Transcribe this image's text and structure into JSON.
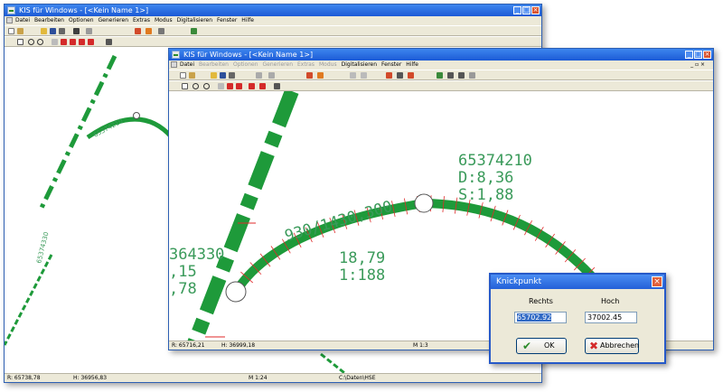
{
  "back_window": {
    "title": "KIS für Windows - [<Kein Name 1>]",
    "menu": [
      "Datei",
      "Bearbeiten",
      "Optionen",
      "Generieren",
      "Extras",
      "Modus",
      "Digitalisieren",
      "Fenster",
      "Hilfe"
    ],
    "status": {
      "rechts": "R: 65738,78",
      "hoch": "H: 36956,83",
      "scale": "M 1:24",
      "path": "C:\\Daten\\HSE"
    },
    "map_labels": {
      "curve": "65374210",
      "line": "65374330"
    }
  },
  "front_window": {
    "title": "KIS für Windows - [<Kein Name 1>]",
    "menu": [
      {
        "label": "Datei",
        "dim": false
      },
      {
        "label": "Bearbeiten",
        "dim": true
      },
      {
        "label": "Optionen",
        "dim": true
      },
      {
        "label": "Generieren",
        "dim": true
      },
      {
        "label": "Extras",
        "dim": true
      },
      {
        "label": "Modus",
        "dim": true
      },
      {
        "label": "Digitalisieren",
        "dim": false
      },
      {
        "label": "Fenster",
        "dim": false
      },
      {
        "label": "Hilfe",
        "dim": false
      }
    ],
    "status": {
      "rechts": "R: 65716,21",
      "hoch": "H: 36999,18",
      "scale": "M 1:3"
    },
    "map_labels": {
      "id": "65374210",
      "d": "D:8,36",
      "s": "S:1,88",
      "radius": "930/1430,300",
      "value1": "18,79",
      "value2": "1:188",
      "left1": "364330",
      "left2": ",15",
      "left3": ",78"
    }
  },
  "dialog": {
    "title": "Knickpunkt",
    "rechts_label": "Rechts",
    "hoch_label": "Hoch",
    "rechts_value": "65702.92",
    "hoch_value": "37002.45",
    "ok_label": "OK",
    "cancel_label": "Abbrechen"
  },
  "colors": {
    "line": "#1e9a3a",
    "text": "#3a9a5a",
    "tick": "#e02a2a",
    "title": "#2360d8"
  }
}
